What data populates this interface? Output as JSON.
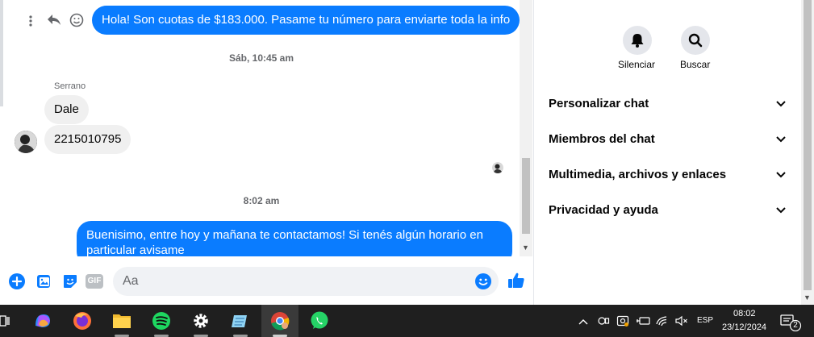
{
  "messages": {
    "top_outgoing": "Hola! Son cuotas de $183.000. Pasame tu número para enviarte toda la info",
    "timestamp_1": "Sáb, 10:45 am",
    "sender_name": "Serrano",
    "incoming_1": "Dale",
    "incoming_2": "2215010795",
    "timestamp_2": "8:02 am",
    "outgoing_2_line1": "Buenisimo, entre hoy y mañana te contactamos! Si tenés algún horario en",
    "outgoing_2_line2": "particular avisame"
  },
  "composer": {
    "placeholder": "Aa",
    "icons": [
      "plus-icon",
      "photo-icon",
      "sticker-icon",
      "gif-icon",
      "emoji-icon",
      "like-icon"
    ],
    "gif_label": "GIF"
  },
  "panel": {
    "mute_label": "Silenciar",
    "search_label": "Buscar",
    "rows": [
      "Personalizar chat",
      "Miembros del chat",
      "Multimedia, archivos y enlaces",
      "Privacidad y ayuda"
    ]
  },
  "taskbar": {
    "apps": [
      "copilot-icon",
      "firefox-icon",
      "file-explorer-icon",
      "spotify-icon",
      "settings-icon",
      "notepad-icon",
      "chrome-icon",
      "whatsapp-icon"
    ],
    "language": "ESP",
    "time": "08:02",
    "date": "23/12/2024",
    "notification_count": "2"
  },
  "colors": {
    "messenger_blue": "#0a7cff",
    "incoming_bubble": "#f0f0f0",
    "taskbar": "#1f1f1f"
  }
}
